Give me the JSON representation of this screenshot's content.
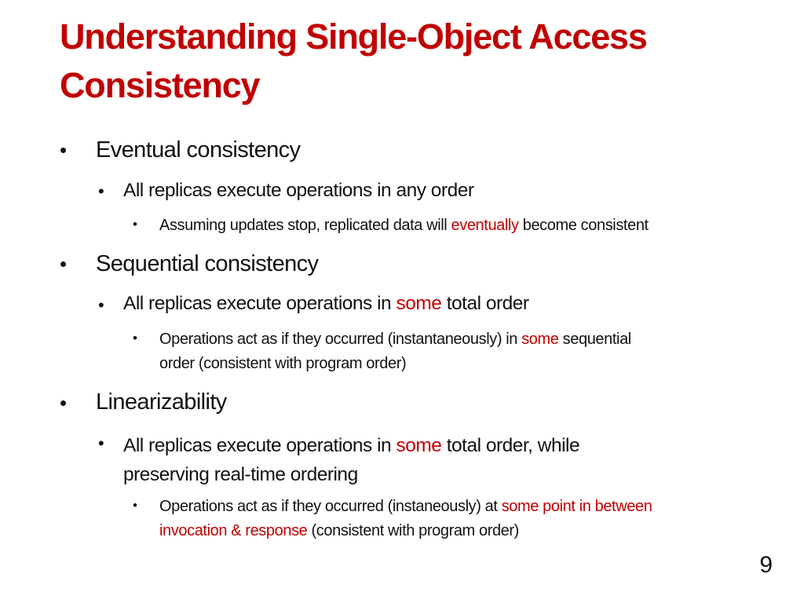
{
  "slide": {
    "title_line1": "Understanding Single-Object Access",
    "title_line2": "Consistency",
    "page_number": "9",
    "accent_color": "#c00000",
    "sections": [
      {
        "heading": "Eventual consistency",
        "sub": "All replicas execute operations in any order",
        "detail": {
          "pre": "Assuming updates stop, replicated data will ",
          "highlight": "eventually",
          "post": " become consistent"
        }
      },
      {
        "heading": "Sequential consistency",
        "sub": {
          "pre": "All replicas execute operations in ",
          "highlight": "some",
          "post": " total order"
        },
        "detail": {
          "pre": "Operations act as if they occurred (instantaneously) in ",
          "highlight": "some",
          "post": " sequential",
          "line2": "order (consistent with program order)"
        }
      },
      {
        "heading": "Linearizability",
        "sub": {
          "pre": "All replicas execute operations in ",
          "highlight": "some",
          "post": " total order, while",
          "line2": "preserving real-time ordering"
        },
        "detail": {
          "pre": "Operations act as if they occurred (instaneously) at ",
          "highlight": "some point in between",
          "highlight2": "invocation & response",
          "post": " (consistent with program order)"
        }
      }
    ]
  }
}
